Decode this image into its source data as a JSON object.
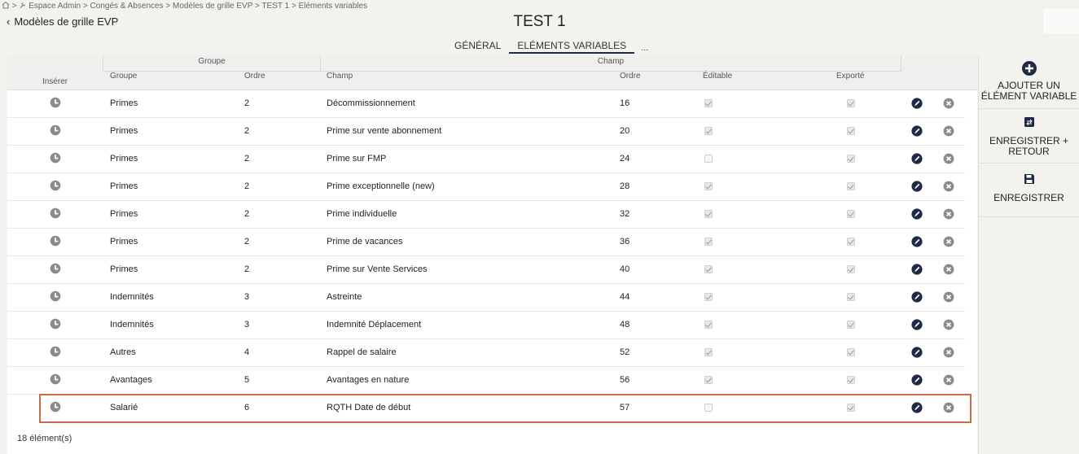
{
  "breadcrumb": {
    "sep": ">",
    "items": [
      "Espace Admin",
      "Congés & Absences",
      "Modèles de grille EVP",
      "TEST 1",
      "Eléments variables"
    ]
  },
  "back": {
    "label": "Modèles de grille EVP"
  },
  "title": "TEST 1",
  "tabs": [
    {
      "label": "GÉNÉRAL",
      "active": false
    },
    {
      "label": "ELÉMENTS VARIABLES",
      "active": true
    }
  ],
  "tabs_more": "...",
  "table": {
    "group_headers": {
      "groupe": "Groupe",
      "champ": "Champ"
    },
    "columns": {
      "inserer": "Insérer",
      "groupe": "Groupe",
      "ordre_groupe": "Ordre",
      "champ": "Champ",
      "ordre_champ": "Ordre",
      "editable": "Éditable",
      "exporte": "Exporté"
    },
    "rows": [
      {
        "groupe": "Primes",
        "ordre_groupe": "2",
        "champ": "Décommissionnement",
        "ordre_champ": "16",
        "editable": true,
        "exporte": true
      },
      {
        "groupe": "Primes",
        "ordre_groupe": "2",
        "champ": "Prime sur vente abonnement",
        "ordre_champ": "20",
        "editable": true,
        "exporte": true
      },
      {
        "groupe": "Primes",
        "ordre_groupe": "2",
        "champ": "Prime sur FMP",
        "ordre_champ": "24",
        "editable": false,
        "exporte": true
      },
      {
        "groupe": "Primes",
        "ordre_groupe": "2",
        "champ": "Prime exceptionnelle (new)",
        "ordre_champ": "28",
        "editable": true,
        "exporte": true
      },
      {
        "groupe": "Primes",
        "ordre_groupe": "2",
        "champ": "Prime individuelle",
        "ordre_champ": "32",
        "editable": true,
        "exporte": true
      },
      {
        "groupe": "Primes",
        "ordre_groupe": "2",
        "champ": "Prime de vacances",
        "ordre_champ": "36",
        "editable": true,
        "exporte": true
      },
      {
        "groupe": "Primes",
        "ordre_groupe": "2",
        "champ": "Prime sur Vente Services",
        "ordre_champ": "40",
        "editable": true,
        "exporte": true
      },
      {
        "groupe": "Indemnités",
        "ordre_groupe": "3",
        "champ": "Astreinte",
        "ordre_champ": "44",
        "editable": true,
        "exporte": true
      },
      {
        "groupe": "Indemnités",
        "ordre_groupe": "3",
        "champ": "Indemnité Déplacement",
        "ordre_champ": "48",
        "editable": true,
        "exporte": true
      },
      {
        "groupe": "Autres",
        "ordre_groupe": "4",
        "champ": "Rappel de salaire",
        "ordre_champ": "52",
        "editable": true,
        "exporte": true
      },
      {
        "groupe": "Avantages",
        "ordre_groupe": "5",
        "champ": "Avantages en nature",
        "ordre_champ": "56",
        "editable": true,
        "exporte": true
      },
      {
        "groupe": "Salarié",
        "ordre_groupe": "6",
        "champ": "RQTH Date de début",
        "ordre_champ": "57",
        "editable": false,
        "exporte": true,
        "selected": true
      }
    ],
    "count": "18 élément(s)"
  },
  "actions": {
    "add": "AJOUTER UN ÉLÉMENT VARIABLE",
    "save_return": "ENREGISTRER + RETOUR",
    "save": "ENREGISTRER"
  },
  "colors": {
    "accent": "#1f2a44",
    "selected_outline": "#c96a4a",
    "icon_grey": "#8a8a8a",
    "background": "#f4f2ef"
  },
  "icons": {
    "insert": "insert-icon",
    "edit": "edit-icon",
    "delete": "delete-icon",
    "add": "plus-circle-icon",
    "save_return": "save-return-icon",
    "save": "floppy-disk-icon"
  }
}
